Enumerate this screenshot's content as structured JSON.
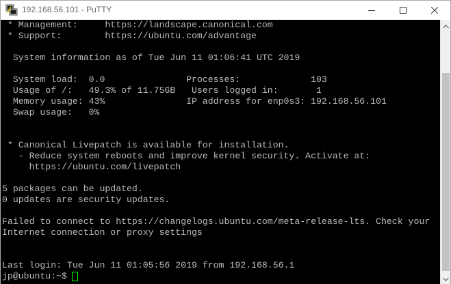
{
  "window": {
    "title": "192.168.56.101 - PuTTY",
    "app_icon": "putty-icon",
    "controls": {
      "minimize_icon": "minimize-icon",
      "maximize_icon": "maximize-icon",
      "close_icon": "close-icon"
    }
  },
  "terminal": {
    "lines": [
      " * Management:     https://landscape.canonical.com",
      " * Support:        https://ubuntu.com/advantage",
      "",
      "  System information as of Tue Jun 11 01:06:41 UTC 2019",
      "",
      "  System load:  0.0               Processes:             103",
      "  Usage of /:   49.3% of 11.75GB   Users logged in:       1",
      "  Memory usage: 43%               IP address for enp0s3: 192.168.56.101",
      "  Swap usage:   0%",
      "",
      "",
      " * Canonical Livepatch is available for installation.",
      "   - Reduce system reboots and improve kernel security. Activate at:",
      "     https://ubuntu.com/livepatch",
      "",
      "5 packages can be updated.",
      "0 updates are security updates.",
      "",
      "Failed to connect to https://changelogs.ubuntu.com/meta-release-lts. Check your",
      "Internet connection or proxy settings",
      "",
      "",
      "Last login: Tue Jun 11 01:05:56 2019 from 192.168.56.1"
    ],
    "prompt": "jp@ubuntu:~$",
    "colors": {
      "background": "#000000",
      "foreground": "#bbbbbb",
      "cursor": "#00ff00"
    }
  },
  "scrollbar": {
    "up_icon": "scroll-up-arrow-icon",
    "down_icon": "scroll-down-arrow-icon"
  }
}
